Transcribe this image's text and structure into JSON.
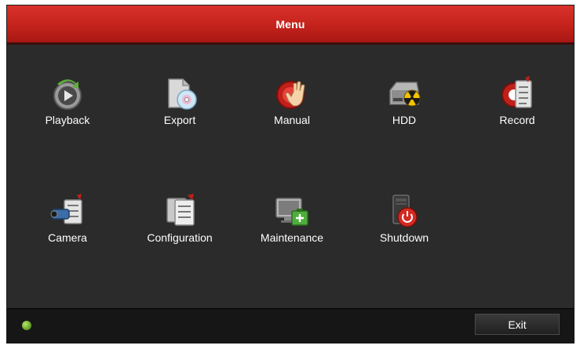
{
  "window": {
    "title": "Menu"
  },
  "menu_items": [
    {
      "label": "Playback",
      "icon": "playback-icon"
    },
    {
      "label": "Export",
      "icon": "export-disc-icon"
    },
    {
      "label": "Manual",
      "icon": "manual-record-hand-icon"
    },
    {
      "label": "HDD",
      "icon": "hdd-warning-icon"
    },
    {
      "label": "Record",
      "icon": "record-settings-icon"
    },
    {
      "label": "Camera",
      "icon": "camera-icon"
    },
    {
      "label": "Configuration",
      "icon": "configuration-icon"
    },
    {
      "label": "Maintenance",
      "icon": "maintenance-monitor-icon"
    },
    {
      "label": "Shutdown",
      "icon": "shutdown-power-icon"
    }
  ],
  "statusbar": {
    "status_icon": "green-status-dot",
    "exit_label": "Exit"
  },
  "colors": {
    "titlebar": "#c4221c",
    "background": "#2b2b2b",
    "statusbar": "#161616",
    "text": "#ffffff"
  }
}
